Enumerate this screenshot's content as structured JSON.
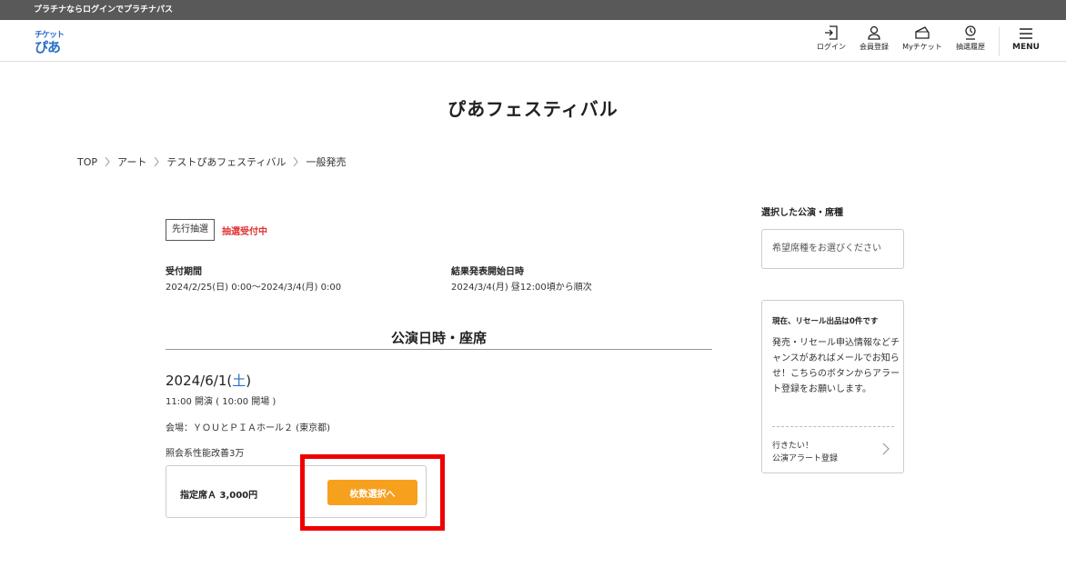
{
  "topbar": {
    "text": "プラチナならログインでプラチナパス"
  },
  "logo": {
    "line1": "チケット",
    "line2": "ぴあ"
  },
  "header_nav": [
    {
      "label": "ログイン",
      "icon": "login-icon"
    },
    {
      "label": "会員登録",
      "icon": "person-icon"
    },
    {
      "label": "Myチケット",
      "icon": "ticket-icon"
    },
    {
      "label": "抽選履歴",
      "icon": "lottery-history-icon"
    }
  ],
  "menu": {
    "label": "MENU"
  },
  "page_title": "ぴあフェスティバル",
  "breadcrumb": [
    "TOP",
    "アート",
    "テストぴあフェスティバル",
    "一般発売"
  ],
  "lottery": {
    "tag": "先行抽選",
    "status": "抽選受付中",
    "period_label": "受付期間",
    "period_value": "2024/2/25(日) 0:00～2024/3/4(月) 0:00",
    "result_label": "結果発表開始日時",
    "result_value": "2024/3/4(月) 昼12:00頃から順次"
  },
  "section_title": "公演日時・座席",
  "performance": {
    "date": "2024/6/1(",
    "dow": "土",
    "date_close": ")",
    "time": "11:00 開演 ( 10:00 開場 )",
    "venue": "会場：ＹＯＵとＰＩＡホール２ (東京都)",
    "note": "照会系性能改善3万"
  },
  "seat": {
    "name": "指定席Ａ 3,000円",
    "button": "枚数選択へ"
  },
  "sidebar": {
    "title": "選択した公演・席種",
    "select_placeholder": "希望席種をお選びください",
    "resale_head": "現在、リセール出品は0件です",
    "resale_body": "発売・リセール申込情報などチャンスがあればメールでお知らせ！こちらのボタンからアラート登録をお願いします。",
    "alert_line1": "行きたい！",
    "alert_line2": "公演アラート登録"
  },
  "colors": {
    "accent_orange": "#f7a01e",
    "status_red": "#e0312f",
    "saturday_blue": "#2a6fc9",
    "highlight_red": "#ee0000"
  }
}
